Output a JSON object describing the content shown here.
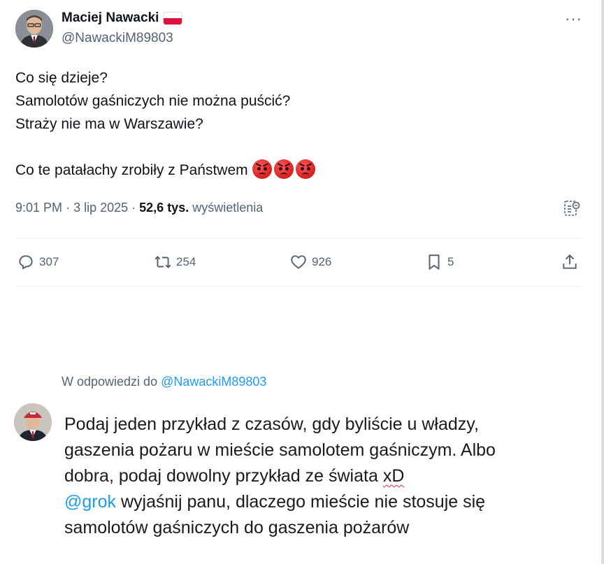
{
  "tweet": {
    "author_name": "Maciej Nawacki",
    "author_handle": "@NawackiM89803",
    "more_label": "···",
    "text_lines": [
      "Co się dzieje?",
      "Samolotów gaśniczych nie można puścić?",
      "Straży nie ma w Warszawie?",
      "",
      "Co te patałachy zrobiły z Państwem"
    ],
    "emoji": [
      "angry-face-emoji",
      "angry-face-emoji",
      "angry-face-emoji"
    ],
    "time": "9:01 PM",
    "date": "3 lip 2025",
    "views_count": "52,6 tys.",
    "views_label": "wyświetlenia",
    "actions": {
      "replies": "307",
      "reposts": "254",
      "likes": "926",
      "bookmarks": "5"
    }
  },
  "reply": {
    "context_prefix": "W odpowiedzi do",
    "context_handle": "@NawackiM89803",
    "lines": [
      "Podaj jeden przykład z czasów, gdy byliście u władzy,",
      "gaszenia pożaru w mieście samolotem gaśniczym. Albo",
      "dobra, podaj dowolny przykład ze świata"
    ],
    "line3_tail": "xD",
    "mention": "@grok",
    "line4_rest": "wyjaśnij panu, dlaczego mieście nie stosuje się",
    "line5": "samolotów gaśniczych do gaszenia pożarów"
  },
  "colors": {
    "accent": "#1d9bf0",
    "secondary_text": "#536471",
    "primary_text": "#0f1419",
    "spellcheck": "#e0245e"
  },
  "icons": [
    "reply-icon",
    "repost-icon",
    "like-icon",
    "bookmark-icon",
    "share-icon",
    "analytics-icon",
    "more-icon"
  ]
}
